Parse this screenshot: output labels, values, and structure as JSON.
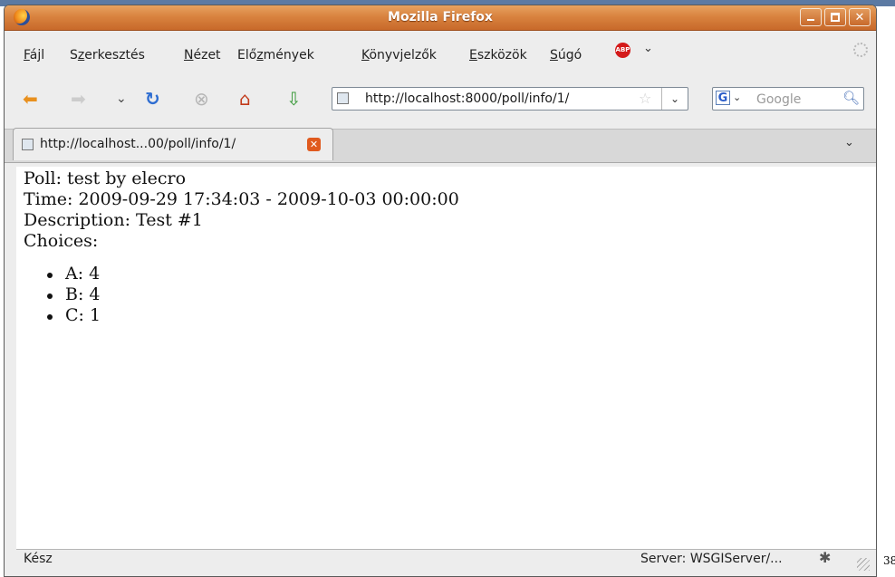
{
  "window": {
    "title": "Mozilla Firefox"
  },
  "menubar": {
    "items": [
      {
        "pre": "",
        "u": "F",
        "post": "ájl"
      },
      {
        "pre": "S",
        "u": "z",
        "post": "erkesztés"
      },
      {
        "pre": "",
        "u": "N",
        "post": "ézet"
      },
      {
        "pre": "Elő",
        "u": "z",
        "post": "mények"
      },
      {
        "pre": "",
        "u": "K",
        "post": "önyvjelzők"
      },
      {
        "pre": "",
        "u": "E",
        "post": "szközök"
      },
      {
        "pre": "",
        "u": "S",
        "post": "úgó"
      }
    ],
    "abp_label": "ABP"
  },
  "navbar": {
    "url": "http://localhost:8000/poll/info/1/",
    "search_engine_letter": "G",
    "search_placeholder": "Google"
  },
  "tab": {
    "label": "http://localhost...00/poll/info/1/"
  },
  "page": {
    "poll": "Poll: test by elecro",
    "time": "Time: 2009-09-29 17:34:03 - 2009-10-03 00:00:00",
    "description": "Description: Test #1",
    "choices_label": "Choices:",
    "choices": [
      "A: 4",
      "B: 4",
      "C: 1"
    ]
  },
  "status": {
    "text": "Kész",
    "server": "Server: WSGIServer/..."
  },
  "side_number": "38",
  "icons": [
    "firefox-icon",
    "minimize-icon",
    "maximize-icon",
    "close-icon",
    "adblock-icon",
    "throbber-icon",
    "back-arrow-icon",
    "forward-arrow-icon",
    "history-dropdown-icon",
    "reload-icon",
    "stop-icon",
    "home-icon",
    "download-icon",
    "page-favicon-icon",
    "bookmark-star-icon",
    "url-dropdown-icon",
    "google-icon",
    "search-magnifier-icon",
    "tab-close-icon",
    "tab-list-icon",
    "firebug-icon",
    "resize-grip-icon"
  ],
  "colors": {
    "titlebar": "#d9833f",
    "tab_close": "#e05a1e",
    "abp": "#d41a1a"
  }
}
